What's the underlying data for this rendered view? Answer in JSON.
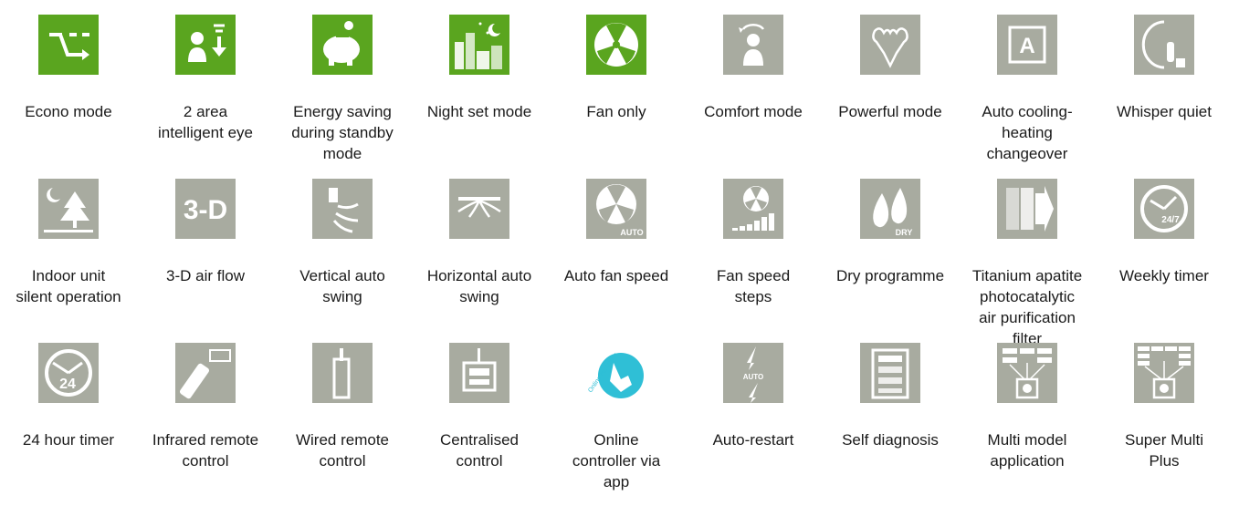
{
  "colors": {
    "green": "#5aa51f",
    "grey": "#a8aba0",
    "cyan": "#2fbfd6"
  },
  "features": [
    {
      "label": "Econo mode",
      "icon": "econo-mode-icon",
      "tile": "green"
    },
    {
      "label": "2 area\nintelligent eye",
      "icon": "intelligent-eye-icon",
      "tile": "green"
    },
    {
      "label": "Energy saving\nduring standby\nmode",
      "icon": "piggy-bank-icon",
      "tile": "green"
    },
    {
      "label": "Night set mode",
      "icon": "night-city-icon",
      "tile": "green"
    },
    {
      "label": "Fan only",
      "icon": "fan-icon",
      "tile": "green"
    },
    {
      "label": "Comfort mode",
      "icon": "comfort-person-icon",
      "tile": "grey"
    },
    {
      "label": "Powerful mode",
      "icon": "powerful-icon",
      "tile": "grey"
    },
    {
      "label": "Auto cooling-\nheating\nchangeover",
      "icon": "auto-changeover-icon",
      "tile": "grey"
    },
    {
      "label": "Whisper quiet",
      "icon": "whisper-icon",
      "tile": "grey"
    },
    {
      "label": "Indoor unit\nsilent operation",
      "icon": "moon-tree-icon",
      "tile": "grey"
    },
    {
      "label": "3-D air flow",
      "icon": "3d-icon",
      "tile": "grey",
      "text": "3-D"
    },
    {
      "label": "Vertical auto\nswing",
      "icon": "vertical-swing-icon",
      "tile": "grey"
    },
    {
      "label": "Horizontal auto\nswing",
      "icon": "horizontal-swing-icon",
      "tile": "grey"
    },
    {
      "label": "Auto fan speed",
      "icon": "auto-fan-icon",
      "tile": "grey",
      "text": "AUTO"
    },
    {
      "label": "Fan speed\nsteps",
      "icon": "fan-speed-steps-icon",
      "tile": "grey"
    },
    {
      "label": "Dry programme",
      "icon": "dry-drops-icon",
      "tile": "grey",
      "text": "DRY"
    },
    {
      "label": "Titanium apatite\nphotocatalytic\nair purification\nfilter",
      "icon": "filter-icon",
      "tile": "grey"
    },
    {
      "label": "Weekly timer",
      "icon": "weekly-clock-icon",
      "tile": "grey",
      "text": "24/7"
    },
    {
      "label": "24 hour timer",
      "icon": "24h-clock-icon",
      "tile": "grey",
      "text": "24"
    },
    {
      "label": "Infrared remote\ncontrol",
      "icon": "infrared-remote-icon",
      "tile": "grey"
    },
    {
      "label": "Wired remote\ncontrol",
      "icon": "wired-remote-icon",
      "tile": "grey"
    },
    {
      "label": "Centralised\ncontrol",
      "icon": "central-control-icon",
      "tile": "grey"
    },
    {
      "label": "Online\ncontroller via\napp",
      "icon": "online-controller-icon",
      "tile": "cyan",
      "text": "Online controller"
    },
    {
      "label": "Auto-restart",
      "icon": "auto-restart-icon",
      "tile": "grey",
      "text": "AUTO"
    },
    {
      "label": "Self diagnosis",
      "icon": "self-diagnosis-icon",
      "tile": "grey"
    },
    {
      "label": "Multi model\napplication",
      "icon": "multi-model-icon",
      "tile": "grey"
    },
    {
      "label": "Super Multi\nPlus",
      "icon": "super-multi-icon",
      "tile": "grey"
    }
  ]
}
